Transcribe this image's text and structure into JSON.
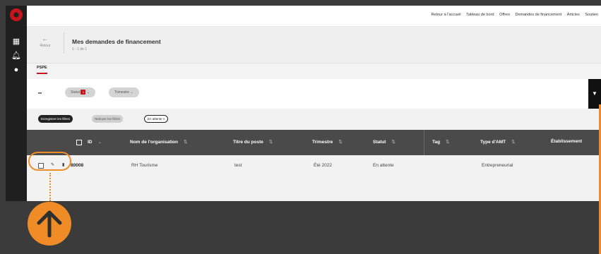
{
  "topnav": {
    "links": [
      "Retour à l'accueil",
      "Tableau de bord",
      "Offres",
      "Demandes de financement",
      "Articles",
      "Soutien"
    ]
  },
  "header": {
    "back_label": "Retour",
    "title": "Mes demandes de financement",
    "count": "1 - 1 de 1"
  },
  "tabs": [
    {
      "label": "PSPE"
    }
  ],
  "filters": {
    "status_label": "Statut",
    "status_count": "1",
    "quarter_label": "Trimestre"
  },
  "actions": {
    "save_filters": "Enregistrer les filtres",
    "clear_filters": "Nettoyer les filtres",
    "pending_chip": "En attente ×"
  },
  "table": {
    "columns": [
      "ID",
      "Nom de l'organisation",
      "Titre du poste",
      "Trimestre",
      "Statut",
      "Tag",
      "Type d'AMT",
      "Établissement"
    ],
    "rows": [
      {
        "id": "80008",
        "organisation": "RH Tourisme",
        "poste": "test",
        "trimestre": "Été 2022",
        "statut": "En attente",
        "tag": "",
        "type": "Entrepreneurial",
        "etablissement": ""
      }
    ]
  },
  "colors": {
    "brand_red": "#c4161c",
    "annotation_orange": "#f08c28"
  }
}
